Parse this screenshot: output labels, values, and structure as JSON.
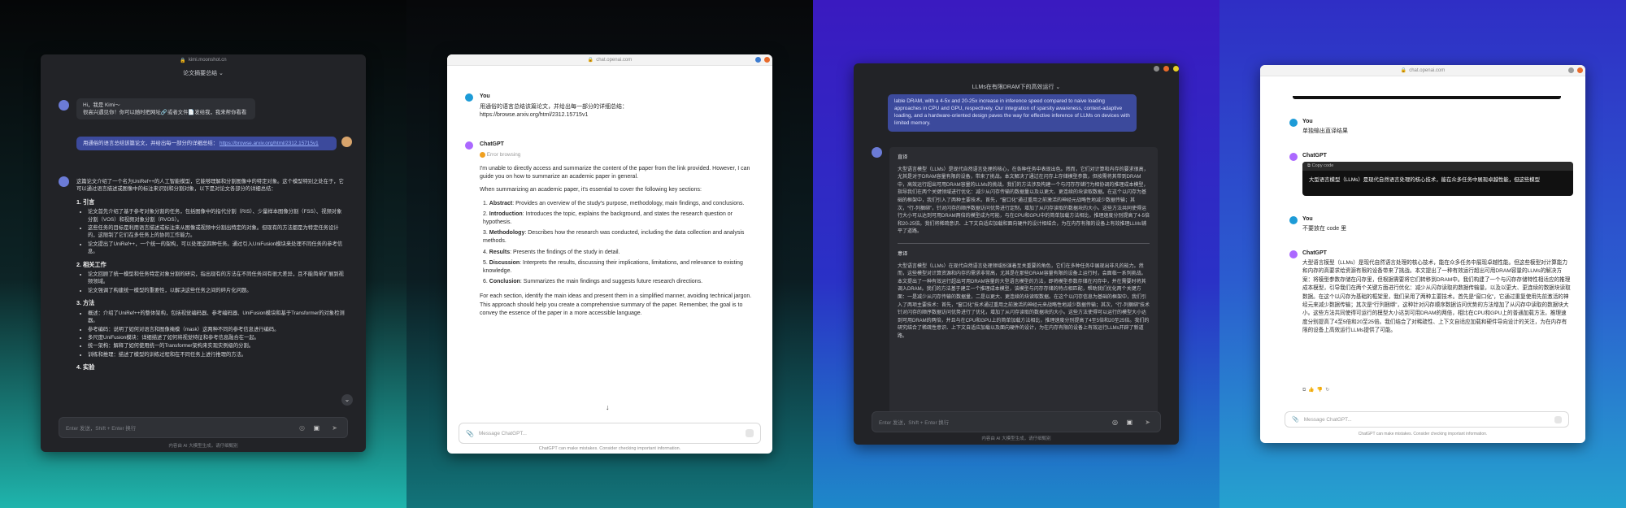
{
  "kimi1": {
    "url": "kimi.moonshot.cn",
    "title": "论文摘要总结 ⌄",
    "greeting_line1": "Hi，我是 Kimi～",
    "greeting_line2": "很高兴遇见你！你可以随时把网址🔗或者文件📄发给我，我来帮你看看",
    "user_msg": "用通俗的语言总结该篇论文，并给出每一部分的详细总结：",
    "user_link": "https://browse.arxiv.org/html/2312.15715v1",
    "intro": "这篇论文介绍了一个名为UniRef++的人工智能模型，它能够理解和分割图像中的特定对象。这个模型特别之处在于，它可以通过语言描述或图像中的标注来识别和分割对象，以下是对论文各部分的详细总结：",
    "sections": [
      {
        "heading": "1. 引言",
        "items": [
          "论文首先介绍了基于参考对象分割的任务，包括图像中的指代分割（RIS）、少量样本图像分割（FSS）、视频对象分割（VOS）和视频对象分割（RVOS）。",
          "这些任务的目标是利用语言描述或标注来从图像或视频中分割出特定的对象。但现有的方法都是为特定任务设计的，这限制了它们在多任务上的协同工作能力。",
          "论文提出了UniRef++，一个统一的架构，可以处理这四种任务。通过引入UniFusion模块来处理不同任务的参考信息。"
        ]
      },
      {
        "heading": "2. 相关工作",
        "items": [
          "论文回顾了统一模型和任务特定对象分割的研究，指出现有的方法在不同任务间有很大差异，且不能简单扩展到视频领域。",
          "论文强调了构建统一模型的重要性，以解决这些任务之间的碎片化问题。"
        ]
      },
      {
        "heading": "3. 方法",
        "items": [
          "概述：介绍了UniRef++的整体架构，包括视觉编码器、参考编码器、UniFusion模块和基于Transformer的对象检测器。",
          "参考编码：说明了如何对语言和图像掩模（mask）这两种不同的参考信息进行编码。",
          "多尺度UniFusion模块：详细描述了如何将视觉特征和参考信息融合在一起。",
          "统一架构：解释了如何使用统一的Transformer架构来实现实例级的分割。",
          "训练和推理：描述了模型的训练过程和在不同任务上进行推理的方法。"
        ]
      },
      {
        "heading": "4. 实验",
        "items": []
      }
    ],
    "input_placeholder": "Enter 发送，Shift + Enter 换行",
    "footer": "内容由 AI 大模型生成，请仔细甄别"
  },
  "gpt1": {
    "url": "chat.openai.com",
    "you_label": "You",
    "user_msg_line1": "用通俗的语言总结该篇论文，并给出每一部分的详细总结：",
    "user_msg_line2": "https://browse.arxiv.org/html/2312.15715v1",
    "assistant_label": "ChatGPT",
    "error_label": "Error browsing",
    "p1": "I'm unable to directly access and summarize the content of the paper from the link provided. However, I can guide you on how to summarize an academic paper in general.",
    "p2": "When summarizing an academic paper, it's essential to cover the following key sections:",
    "list": [
      {
        "n": "1.",
        "b": "Abstract",
        "t": ": Provides an overview of the study's purpose, methodology, main findings, and conclusions."
      },
      {
        "n": "2.",
        "b": "Introduction",
        "t": ": Introduces the topic, explains the background, and states the research question or hypothesis."
      },
      {
        "n": "3.",
        "b": "Methodology",
        "t": ": Describes how the research was conducted, including the data collection and analysis methods."
      },
      {
        "n": "4.",
        "b": "Results",
        "t": ": Presents the findings of the study in detail."
      },
      {
        "n": "5.",
        "b": "Discussion",
        "t": ": Interprets the results, discussing their implications, limitations, and relevance to existing knowledge."
      },
      {
        "n": "6.",
        "b": "Conclusion",
        "t": ": Summarizes the main findings and suggests future research directions."
      }
    ],
    "p3": "For each section, identify the main ideas and present them in a simplified manner, avoiding technical jargon. This approach should help you create a comprehensive summary of the paper. Remember, the goal is to convey the essence of the paper in a more accessible language.",
    "input_placeholder": "Message ChatGPT...",
    "footer": "ChatGPT can make mistakes. Consider checking important information."
  },
  "kimi2": {
    "title": "LLMs在有限DRAM下的高效运行 ⌄",
    "user_text": "lable DRAM, with a 4-5x and 20-25x increase in inference speed compared to naive loading approaches in CPU and GPU, respectively. Our integration of sparsity awareness, context-adaptive loading, and a hardware-oriented design paves the way for effective inference of LLMs on devices with limited memory.",
    "label_zh": "直译",
    "zh_text": "大型语言模型（LLMs）是现代自然语言处理的核心，在各种任务中表现出色。然而，它们对计算和内存的要求很高，尤其是对于DRAM容量有限的设备，带来了挑战。本文解决了通过在闪存上存储模型参数，但按需将其带到DRAM中，高效运行超出可用DRAM容量的LLMs的挑战。我们的方法涉及构建一个与闪存存储行为相协调的推理成本模型，指导我们在两个关键领域进行优化：减少从闪存传输的数据量以及以更大、更连续的块读取数据。在这个以闪存为基础的框架中，我们引入了两种主要技术。首先，“窗口化”通过重用之前激活的神经元战略性地减少数据传输；其次，“行-列捆绑”，针对闪存的顺序数据访问优势进行定制，增加了从闪存读取的数据块的大小。这些方法共同使得运行大小可以达到可用DRAM两倍的模型成为可能，与在CPU和GPU中的简单加载方法相比，推理速度分别提高了4-5倍和20-25倍。我们将稀疏意识、上下文自适应加载和面向硬件的设计相结合，为在内存有限的设备上有效推理LLMs铺平了道路。",
    "label_yi": "意译",
    "yi_text": "大型语言模型（LLMs）在现代自然语言处理领域扮演着至关重要的角色，它们在多种任务中展现出非凡的能力。然而，这些模型对计算资源和内存的需求非常高，尤其是在那些DRAM容量有限的设备上运行时，会面临一系列挑战。本文提出了一种有效运行超出可用DRAM容量的大型语言模型的方法，即将模型参数存储在闪存中，并在需要时将其调入DRAM。我们的方法基于建立一个推理成本模型，该模型与闪存存储的特点相匹配，帮助我们优化两个关键方面：一是减少从闪存传输的数据量，二是以更大、更连续的块读取数据。在这个以闪存信息为基础的框架中，我们引入了两项主要技术：首先，“窗口化”技术通过重用之前激活的神经元来战略性地减少数据传输；其次，“行-列捆绑”技术针对闪存的顺序数据访问优势进行了优化，增加了从闪存读取的数据块的大小。这些方法使得可以运行的模型大小达到可用DRAM的两倍，并且与在CPU和GPU上的简单加载方法相比，推理速度分别提高了4至5倍和20至25倍。我们的研究结合了稀疏性意识、上下文自适应加载以及面向硬件的设计，为在内存有限的设备上有效运行LLMs开辟了新道路。",
    "input_placeholder": "Enter 发送，Shift + Enter 换行",
    "footer": "内容由 AI 大模型生成，请仔细甄别"
  },
  "gpt2": {
    "url": "chat.openai.com",
    "you_label": "You",
    "user1": "单独输出直译结果",
    "assistant_label": "ChatGPT",
    "code_header": "Copy code",
    "code_text": "大型语言模型（LLMs）是现代自然语言处理的核心技术，能在众多任务中展现卓越性能，但这些模型",
    "user2": "不要放在 code 里",
    "answer": "大型语言模型（LLMs）是现代自然语言处理的核心技术，能在众多任务中展现卓越性能。但这些模型对计算能力和内存的高要求给资源有限的设备带来了挑战。本文提出了一种有效运行超出可用DRAM容量的LLMs的解决方案：将模型参数存储在闪存里，但根据需要将它们转移到DRAM中。我们构建了一个与闪存存储特性相适应的推理成本模型，引导我们在两个关键方面进行优化：减少从闪存读取的数据传输量，以及以更大、更连续的数据块读取数据。在这个以闪存为基础的框架里，我们采用了两种主要技术。首先是“窗口化”，它通过重复使用先前激活的神经元来减少数据传输；其次是“行列捆绑”，这种针对闪存顺序数据访问优势的方法增加了从闪存中读取的数据块大小。这些方法共同使得可运行的模型大小达到可用DRAM的两倍，相比在CPU和GPU上的普通加载方法，推理速度分别提高了4至5倍和20至25倍。我们结合了对稀疏性、上下文自适应加载和硬件导向设计的关注，为在内存有限的设备上高效运行LLMs提供了可能。",
    "input_placeholder": "Message ChatGPT...",
    "footer": "ChatGPT can make mistakes. Consider checking important information."
  }
}
